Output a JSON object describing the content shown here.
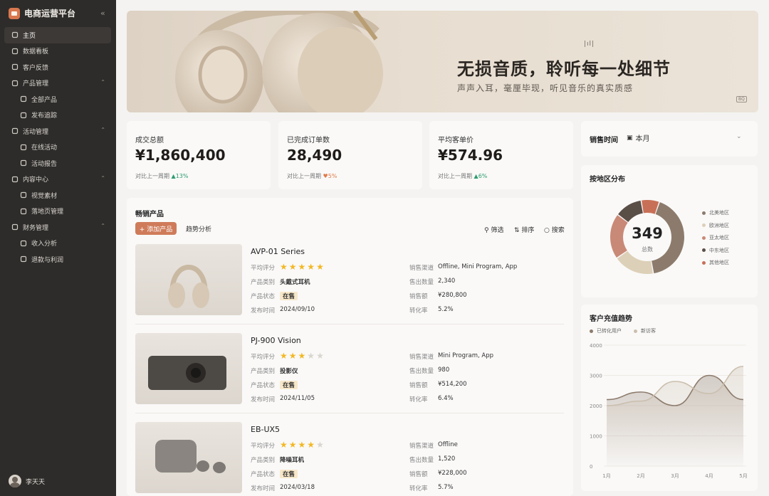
{
  "sidebar": {
    "title": "电商运营平台",
    "collapse_icon": "«",
    "items": [
      {
        "label": "主页",
        "icon": "home-icon",
        "active": true
      },
      {
        "label": "数据看板",
        "icon": "chart-icon"
      },
      {
        "label": "客户反馈",
        "icon": "heart-icon"
      },
      {
        "label": "产品管理",
        "icon": "box-icon",
        "expandable": true
      },
      {
        "label": "全部产品",
        "icon": "cube-icon",
        "sub": true
      },
      {
        "label": "发布追踪",
        "icon": "trend-icon",
        "sub": true
      },
      {
        "label": "活动管理",
        "icon": "bar-icon",
        "expandable": true
      },
      {
        "label": "在线活动",
        "icon": "gamepad-icon",
        "sub": true
      },
      {
        "label": "活动报告",
        "icon": "layers-icon",
        "sub": true
      },
      {
        "label": "内容中心",
        "icon": "globe-icon",
        "expandable": true
      },
      {
        "label": "视觉素材",
        "icon": "smile-icon",
        "sub": true
      },
      {
        "label": "落地页管理",
        "icon": "page-icon",
        "sub": true
      },
      {
        "label": "财务管理",
        "icon": "bulb-icon",
        "expandable": true
      },
      {
        "label": "收入分析",
        "icon": "diamond-icon",
        "sub": true
      },
      {
        "label": "退款与利润",
        "icon": "list-icon",
        "sub": true
      }
    ],
    "user_name": "李天天"
  },
  "banner": {
    "title": "无损音质，聆听每一处细节",
    "subtitle": "声声入耳，毫厘毕现，听见音乐的真实质感",
    "badge": "BQ"
  },
  "kpis": [
    {
      "label": "成交总额",
      "value": "¥1,860,400",
      "compare_label": "对比上一周期",
      "change": "13%",
      "direction": "up"
    },
    {
      "label": "已完成订单数",
      "value": "28,490",
      "compare_label": "对比上一周期",
      "change": "5%",
      "direction": "down"
    },
    {
      "label": "平均客单价",
      "value": "¥574.96",
      "compare_label": "对比上一周期",
      "change": "6%",
      "direction": "up"
    }
  ],
  "sales_time": {
    "label": "销售时间",
    "value": "本月"
  },
  "products": {
    "title": "畅销产品",
    "add_label": "+ 添加产品",
    "trend_label": "趋势分析",
    "filter_label": "筛选",
    "sort_label": "排序",
    "search_label": "搜索",
    "field_labels": {
      "rating": "平均评分",
      "category": "产品类别",
      "status": "产品状态",
      "date": "发布时间",
      "channel": "销售渠道",
      "quantity": "售出数量",
      "amount": "销售额",
      "conversion": "转化率"
    },
    "items": [
      {
        "name": "AVP-01 Series",
        "rating": 5,
        "category": "头戴式耳机",
        "status": "在售",
        "date": "2024/09/10",
        "channel": "Offline, Mini Program, App",
        "quantity": "2,340",
        "amount": "¥280,800",
        "conversion": "5.2%"
      },
      {
        "name": "PJ-900 Vision",
        "rating": 3,
        "category": "投影仪",
        "status": "在售",
        "date": "2024/11/05",
        "channel": "Mini Program, App",
        "quantity": "980",
        "amount": "¥514,200",
        "conversion": "6.4%"
      },
      {
        "name": "EB-UX5",
        "rating": 4,
        "category": "降噪耳机",
        "status": "在售",
        "date": "2024/03/18",
        "channel": "Offline",
        "quantity": "1,520",
        "amount": "¥228,000",
        "conversion": "5.7%"
      }
    ]
  },
  "region": {
    "title": "按地区分布",
    "total": "349",
    "total_label": "总数",
    "legend": [
      {
        "name": "北美地区",
        "color": "#8c7b6c"
      },
      {
        "name": "欧洲地区",
        "color": "#ddd0b8"
      },
      {
        "name": "亚太地区",
        "color": "#c98977"
      },
      {
        "name": "中东地区",
        "color": "#5a4f47"
      },
      {
        "name": "其他地区",
        "color": "#c87057"
      }
    ]
  },
  "chart_data": {
    "type": "line",
    "title": "客户充值趋势",
    "categories": [
      "1月",
      "2月",
      "3月",
      "4月",
      "5月"
    ],
    "ylim": [
      0,
      4000
    ],
    "yticks": [
      0,
      1000,
      2000,
      3000,
      4000
    ],
    "series": [
      {
        "name": "已转化用户",
        "color": "#8c7b6c",
        "values": [
          2200,
          2450,
          2000,
          3000,
          2200
        ]
      },
      {
        "name": "新访客",
        "color": "#cbbfae",
        "values": [
          2000,
          2150,
          2800,
          2400,
          3300
        ]
      }
    ]
  }
}
